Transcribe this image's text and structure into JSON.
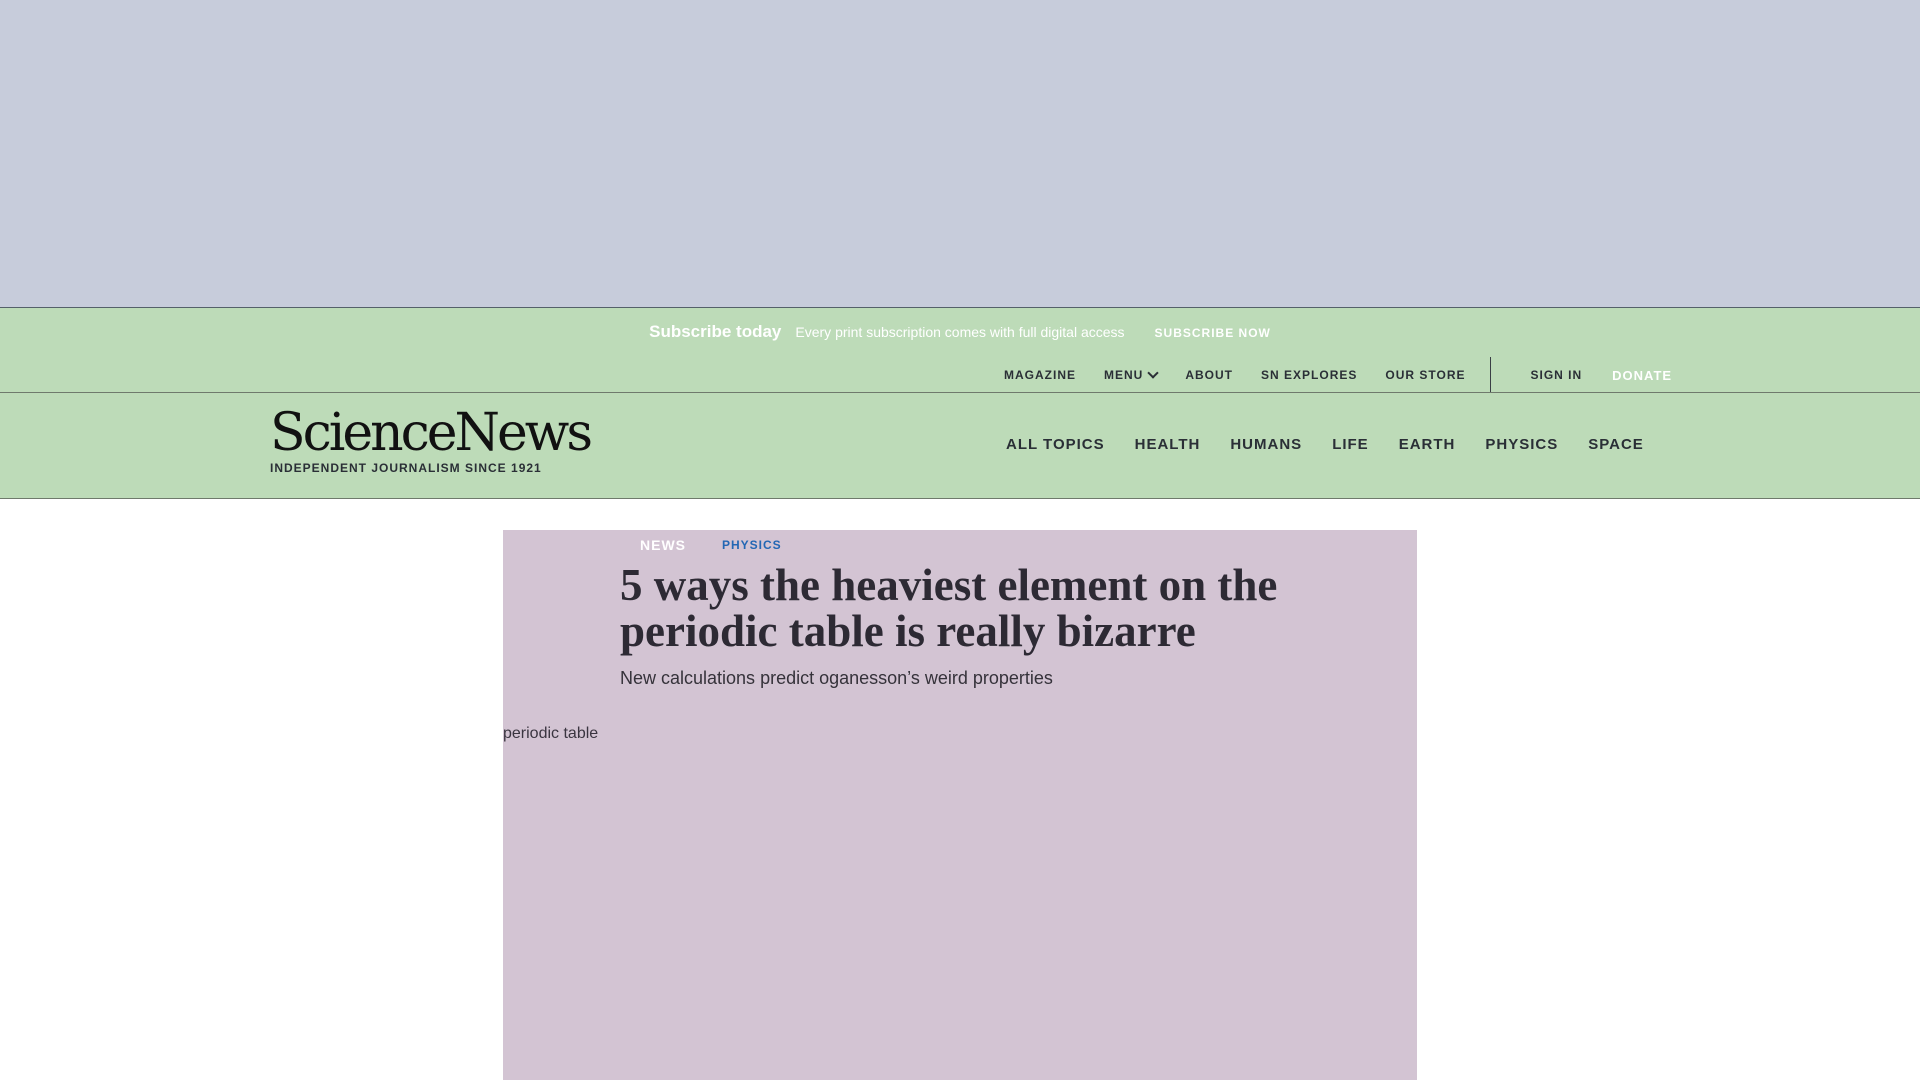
{
  "subscribe": {
    "title": "Subscribe today",
    "text": "Every print subscription comes with full digital access",
    "link": "SUBSCRIBE NOW"
  },
  "utility_nav": {
    "magazine": "MAGAZINE",
    "menu": "MENU",
    "about": "ABOUT",
    "sn_explores": "SN EXPLORES",
    "our_store": "OUR STORE",
    "sign_in": "SIGN IN",
    "donate": "DONATE"
  },
  "logo": {
    "name": "ScienceNews",
    "tagline": "INDEPENDENT JOURNALISM SINCE 1921"
  },
  "main_nav": {
    "items": [
      "ALL TOPICS",
      "HEALTH",
      "HUMANS",
      "LIFE",
      "EARTH",
      "PHYSICS",
      "SPACE"
    ]
  },
  "article": {
    "type_tag": "NEWS",
    "topic_tag": "PHYSICS",
    "headline": "5 ways the heaviest element on the periodic table is really bizarre",
    "dek": "New calculations predict oganesson’s weird properties",
    "image_alt": "periodic table"
  },
  "colors": {
    "ad_background": "#c7ccdb",
    "header_background": "#bddbb8",
    "article_background": "#d3c4d3",
    "topic_link": "#2367b4"
  },
  "icons": {
    "menu": "chevron-down-icon"
  }
}
